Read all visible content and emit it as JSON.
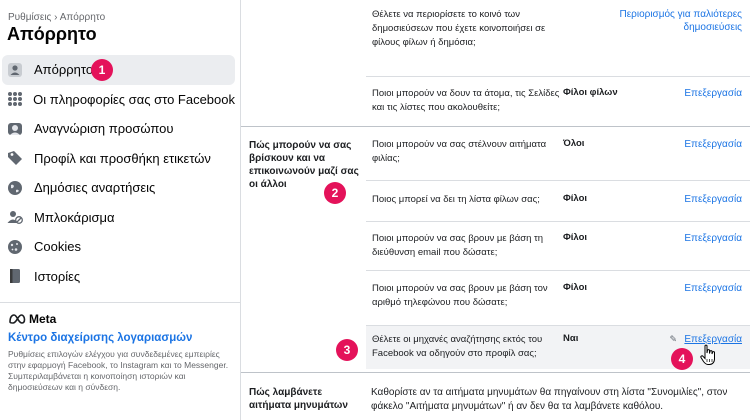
{
  "sidebar": {
    "breadcrumb": "Ρυθμίσεις › Απόρρητο",
    "title": "Απόρρητο",
    "items": [
      {
        "label": "Απόρρητο",
        "icon": "lock-person-icon",
        "active": true
      },
      {
        "label": "Οι πληροφορίες σας στο Facebook",
        "icon": "grid-icon"
      },
      {
        "label": "Αναγνώριση προσώπου",
        "icon": "face-icon"
      },
      {
        "label": "Προφίλ και προσθήκη ετικετών",
        "icon": "tag-icon"
      },
      {
        "label": "Δημόσιες αναρτήσεις",
        "icon": "globe-icon"
      },
      {
        "label": "Μπλοκάρισμα",
        "icon": "block-user-icon"
      },
      {
        "label": "Cookies",
        "icon": "cookie-icon"
      },
      {
        "label": "Ιστορίες",
        "icon": "book-icon"
      }
    ],
    "meta": {
      "logo_text": "Meta",
      "link": "Κέντρο διαχείρισης λογαριασμών",
      "description": "Ρυθμίσεις επιλογών ελέγχου για συνδεδεμένες εμπειρίες στην εφαρμογή Facebook, το Instagram και το Messenger. Συμπεριλαμβάνεται η κοινοποίηση ιστοριών και δημοσιεύσεων και η σύνδεση."
    }
  },
  "main": {
    "rows": [
      {
        "question": "Θέλετε να περιορίσετε το κοινό των δημοσιεύσεων που έχετε κοινοποιήσει σε φίλους φίλων ή δημόσια;",
        "value": "",
        "action": "Περιορισμός για παλιότερες δημοσιεύσεις"
      },
      {
        "question": "Ποιοι μπορούν να δουν τα άτομα, τις Σελίδες και τις λίστες που ακολουθείτε;",
        "value": "Φίλοι φίλων",
        "action": "Επεξεργασία"
      },
      {
        "question": "Ποιοι μπορούν να σας στέλνουν αιτήματα φιλίας;",
        "value": "Όλοι",
        "action": "Επεξεργασία"
      },
      {
        "question": "Ποιος μπορεί να δει τη λίστα φίλων σας;",
        "value": "Φίλοι",
        "action": "Επεξεργασία"
      },
      {
        "question": "Ποιοι μπορούν να σας βρουν με βάση τη διεύθυνση email που δώσατε;",
        "value": "Φίλοι",
        "action": "Επεξεργασία"
      },
      {
        "question": "Ποιοι μπορούν να σας βρουν με βάση τον αριθμό τηλεφώνου που δώσατε;",
        "value": "Φίλοι",
        "action": "Επεξεργασία"
      },
      {
        "question": "Θέλετε οι μηχανές αναζήτησης εκτός του Facebook να οδηγούν στο προφίλ σας;",
        "value": "Ναι",
        "action": "Επεξεργασία"
      }
    ],
    "section_find": "Πώς μπορούν να σας βρίσκουν και να επικοινωνούν μαζί σας οι άλλοι",
    "section_messages": "Πώς λαμβάνετε αιτήματα μηνυμάτων",
    "messages_text": "Καθορίστε αν τα αιτήματα μηνυμάτων θα πηγαίνουν στη λίστα \"Συνομιλίες\", στον φάκελο \"Αιτήματα μηνυμάτων\" ή αν δεν θα τα λαμβάνετε καθόλου."
  },
  "badges": [
    "1",
    "2",
    "3",
    "4"
  ],
  "colors": {
    "accent": "#1b74e4",
    "badge": "#e4125a",
    "active_bg": "#ebedf0"
  }
}
